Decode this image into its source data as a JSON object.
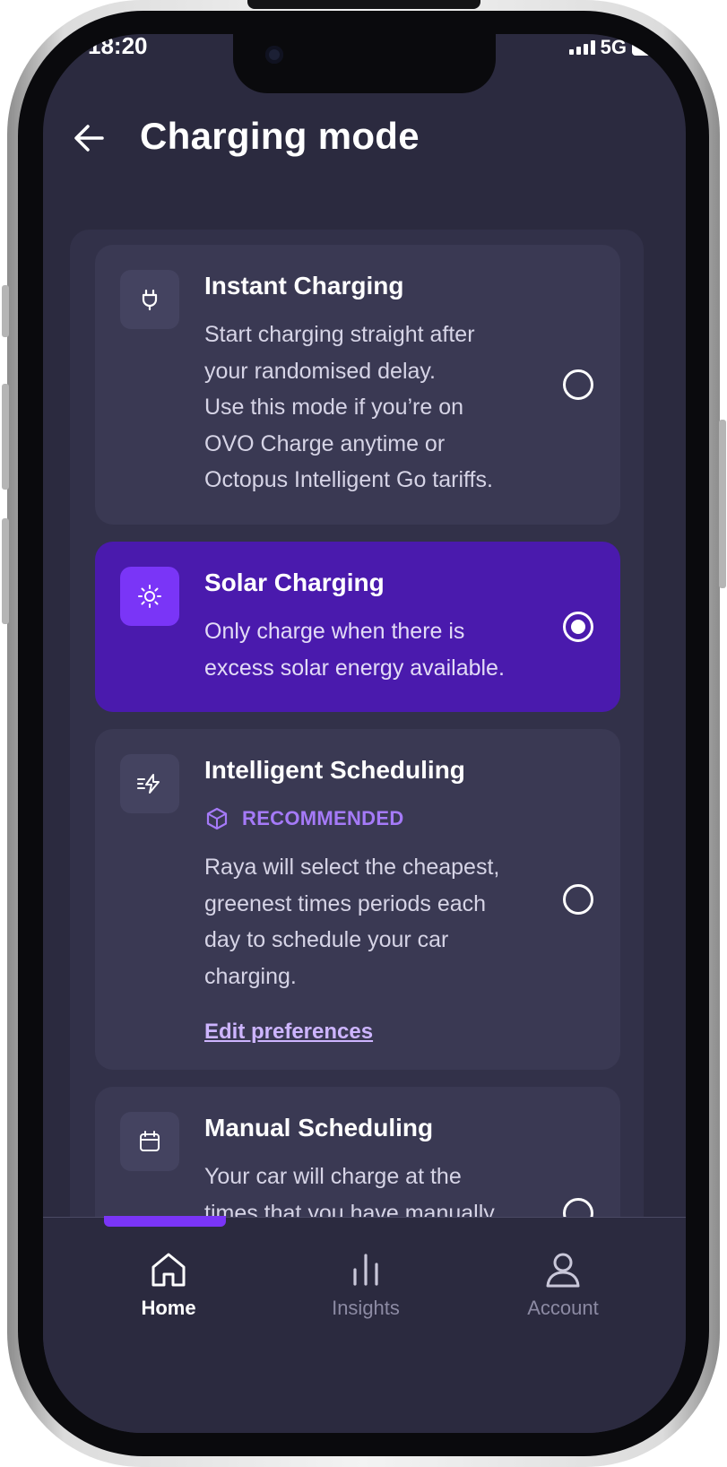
{
  "status_bar": {
    "time": "18:20",
    "network": "5G"
  },
  "header": {
    "title": "Charging mode"
  },
  "modes": [
    {
      "title": "Instant Charging",
      "description": "Start charging straight after\nyour randomised delay.\nUse this mode if you’re on\nOVO Charge anytime or\nOctopus Intelligent Go tariffs.",
      "icon": "plug-icon",
      "selected": false
    },
    {
      "title": "Solar Charging",
      "description": "Only charge when there is\nexcess solar energy available.",
      "icon": "sun-icon",
      "selected": true
    },
    {
      "title": "Intelligent Scheduling",
      "badge": "RECOMMENDED",
      "description": "Raya will select the cheapest,\ngreenest times periods each\nday to schedule your car\ncharging.",
      "link": "Edit preferences",
      "icon": "lightning-icon",
      "selected": false
    },
    {
      "title": "Manual Scheduling",
      "description": "Your car will charge at the\ntimes that you have manually",
      "icon": "calendar-icon",
      "selected": false
    }
  ],
  "nav": [
    {
      "label": "Home",
      "icon": "home-icon",
      "active": true
    },
    {
      "label": "Insights",
      "icon": "bar-chart-icon",
      "active": false
    },
    {
      "label": "Account",
      "icon": "user-icon",
      "active": false
    }
  ],
  "colors": {
    "background": "#2b2a3f",
    "card": "#3a3953",
    "selected_card": "#4a1aad",
    "accent": "#7a35f7",
    "recommended": "#a57af8"
  }
}
